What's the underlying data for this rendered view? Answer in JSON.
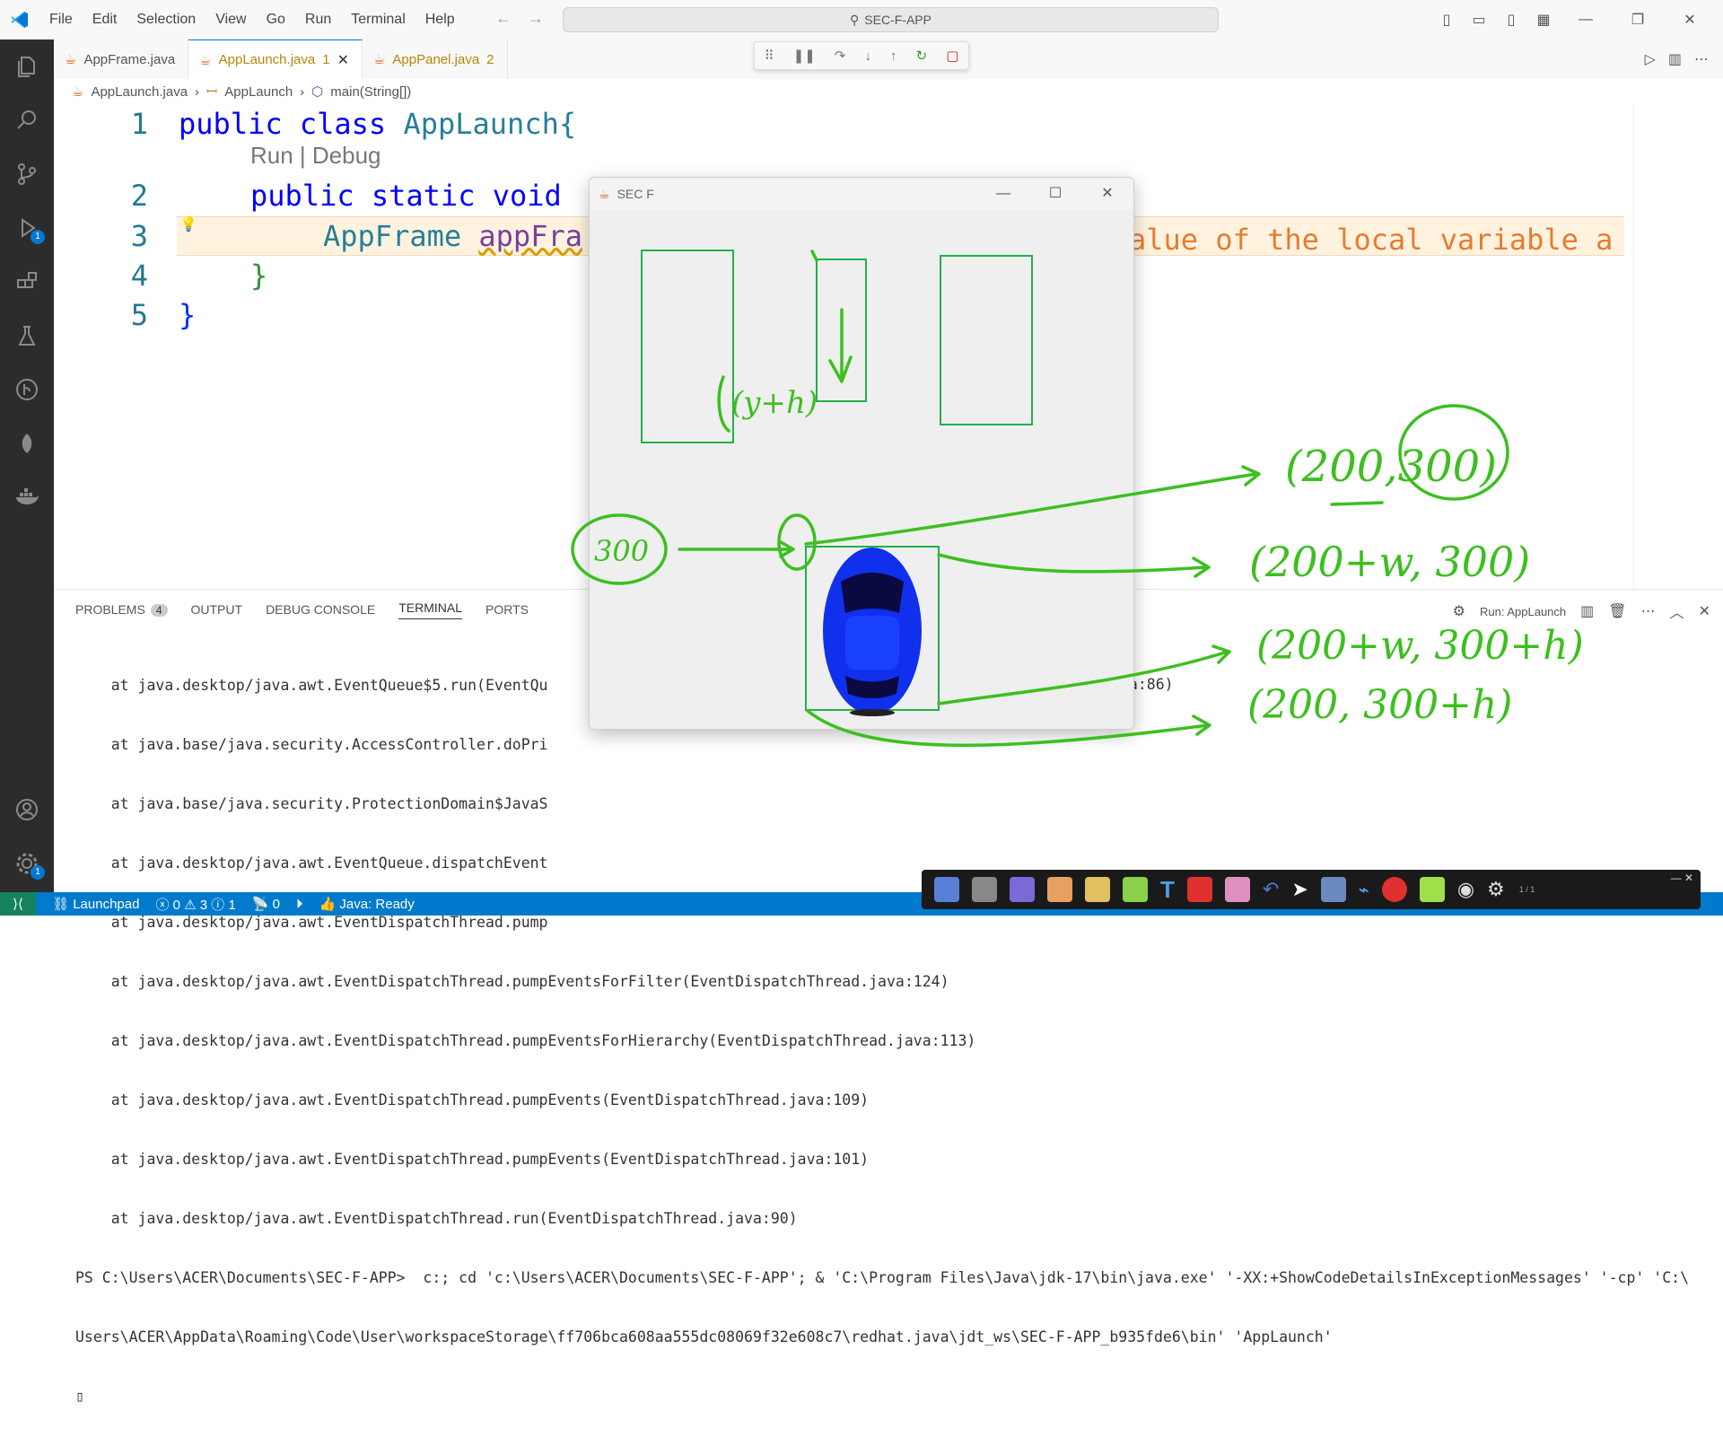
{
  "menu": [
    "File",
    "Edit",
    "Selection",
    "View",
    "Go",
    "Run",
    "Terminal",
    "Help"
  ],
  "search": {
    "label": "SEC-F-APP"
  },
  "activity_badges": {
    "run_debug": "1",
    "accounts": "1"
  },
  "tabs": [
    {
      "label": "AppFrame.java",
      "badge": ""
    },
    {
      "label": "AppLaunch.java",
      "badge": "1"
    },
    {
      "label": "AppPanel.java",
      "badge": "2"
    }
  ],
  "breadcrumb": {
    "file": "AppLaunch.java",
    "class": "AppLaunch",
    "method": "main(String[])"
  },
  "editor": {
    "codelens": "Run | Debug",
    "line_numbers": [
      "1",
      "2",
      "3",
      "4",
      "5"
    ],
    "line1_kw": "public class ",
    "line1_cls": "AppLaunch{",
    "line2_kw": "public static void",
    "line3_cls": "AppFrame ",
    "line3_var": "appFra",
    "line3_msg": "alue of the local variable a",
    "line4": "}",
    "line5": "}"
  },
  "panel": {
    "tabs": [
      "PROBLEMS",
      "OUTPUT",
      "DEBUG CONSOLE",
      "TERMINAL",
      "PORTS"
    ],
    "problems_count": "4",
    "run_label": "Run: AppLaunch",
    "terminal_lines": [
      "    at java.desktop/java.awt.EventQueue$5.run(EventQu",
      "    at java.base/java.security.AccessController.doPri",
      "    at java.base/java.security.ProtectionDomain$JavaS",
      "    at java.desktop/java.awt.EventQueue.dispatchEvent",
      "    at java.desktop/java.awt.EventDispatchThread.pump",
      "    at java.desktop/java.awt.EventDispatchThread.pumpEventsForFilter(EventDispatchThread.java:124)",
      "    at java.desktop/java.awt.EventDispatchThread.pumpEventsForHierarchy(EventDispatchThread.java:113)",
      "    at java.desktop/java.awt.EventDispatchThread.pumpEvents(EventDispatchThread.java:109)",
      "    at java.desktop/java.awt.EventDispatchThread.pumpEvents(EventDispatchThread.java:101)",
      "    at java.desktop/java.awt.EventDispatchThread.run(EventDispatchThread.java:90)"
    ],
    "terminal_fragment": "va:86)",
    "prompt": "PS C:\\Users\\ACER\\Documents\\SEC-F-APP>  c:; cd 'c:\\Users\\ACER\\Documents\\SEC-F-APP'; & 'C:\\Program Files\\Java\\jdk-17\\bin\\java.exe' '-XX:+ShowCodeDetailsInExceptionMessages' '-cp' 'C:\\",
    "prompt_cont": "Users\\ACER\\AppData\\Roaming\\Code\\User\\workspaceStorage\\ff706bca608aa555dc08069f32e608c7\\redhat.java\\jdt_ws\\SEC-F-APP_b935fde6\\bin' 'AppLaunch'"
  },
  "status": {
    "launchpad": "Launchpad",
    "errors": "0",
    "warnings": "3",
    "infos": "1",
    "ports": "0",
    "java": "Java: Ready"
  },
  "java_window": {
    "title": "SEC F"
  },
  "ink_toolbar": {
    "page": "1 / 1"
  },
  "annotations": {
    "yh": "(y+h)",
    "n300": "300",
    "pt1": "(200,300)",
    "pt2": "(200+w, 300)",
    "pt3": "(200+w, 300+h)",
    "pt4": "(200, 300+h)"
  },
  "colors": {
    "accent": "#007acc",
    "ink": "#3cbf1f",
    "obstacle": "#22b14c",
    "car": "#1030ee"
  }
}
